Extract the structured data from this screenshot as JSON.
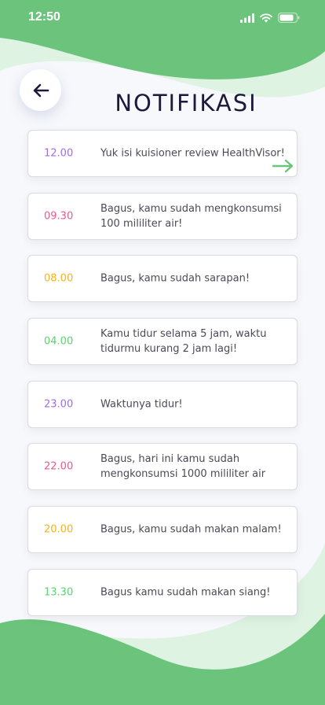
{
  "status": {
    "time": "12:50"
  },
  "header": {
    "title": "NOTIFIKASI",
    "back_icon": "arrow-left-icon"
  },
  "colors": {
    "primary_green": "#6cc47c",
    "purple": "#a06ee0",
    "pink": "#e85c8c",
    "orange": "#f5b21c",
    "green": "#5bd36f"
  },
  "notifications": [
    {
      "time": "12.00",
      "color": "#a06ee0",
      "text": "Yuk isi kuisioner review HealthVisor!",
      "has_arrow": true
    },
    {
      "time": "09.30",
      "color": "#e85c8c",
      "text": "Bagus, kamu sudah mengkonsumsi 100 mililiter air!"
    },
    {
      "time": "08.00",
      "color": "#f5b21c",
      "text": "Bagus, kamu sudah sarapan!"
    },
    {
      "time": "04.00",
      "color": "#5bd36f",
      "text": "Kamu tidur selama 5 jam, waktu tidurmu kurang 2 jam lagi!"
    },
    {
      "time": "23.00",
      "color": "#a06ee0",
      "text": "Waktunya tidur!"
    },
    {
      "time": "22.00",
      "color": "#e85c8c",
      "text": "Bagus, hari ini kamu sudah mengkonsumsi 1000 mililiter air"
    },
    {
      "time": "20.00",
      "color": "#f5b21c",
      "text": "Bagus, kamu sudah makan malam!"
    },
    {
      "time": "13.30",
      "color": "#5bd36f",
      "text": "Bagus kamu sudah makan siang!"
    }
  ]
}
